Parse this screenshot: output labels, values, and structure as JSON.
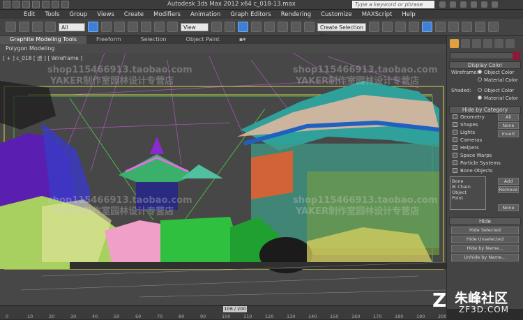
{
  "window": {
    "title": "Autodesk 3ds Max  2012 x64      c_018-13.max",
    "search_placeholder": "Type a keyword or phrase"
  },
  "menu": [
    "Edit",
    "Tools",
    "Group",
    "Views",
    "Create",
    "Modifiers",
    "Animation",
    "Graph Editors",
    "Rendering",
    "Customize",
    "MAXScript",
    "Help"
  ],
  "toolbar": {
    "filter_value": "All",
    "refcoord_value": "View",
    "selection_set_value": "Create Selection Se"
  },
  "ribbon": {
    "tabs": [
      "Graphite Modeling Tools",
      "Freeform",
      "Selection",
      "Object Paint"
    ],
    "active_tab": "Graphite Modeling Tools",
    "sub_label": "Polygon Modeling"
  },
  "viewport": {
    "label": "[ + ] c_018 [ 透 ] [ Wireframe ]",
    "watermark": "shop115466913.taobao.com",
    "watermark_cn": "YAKER制作室园林设计专营店"
  },
  "command_panel": {
    "display_color": {
      "title": "Display Color",
      "wireframe_label": "Wireframe:",
      "shaded_label": "Shaded:",
      "opt_object": "Object Color",
      "opt_material": "Material Color"
    },
    "hide_by_category": {
      "title": "Hide by Category",
      "items": [
        "Geometry",
        "Shapes",
        "Lights",
        "Cameras",
        "Helpers",
        "Space Warps",
        "Particle Systems",
        "Bone Objects"
      ],
      "all_btn": "All",
      "none_btn": "None",
      "invert_btn": "Invert",
      "list_items": [
        "Bone",
        "IK Chain Object",
        "Point"
      ],
      "add_btn": "Add",
      "remove_btn": "Remove",
      "none2_btn": "None"
    },
    "hide": {
      "title": "Hide",
      "buttons": [
        "Hide Selected",
        "Hide Unselected",
        "Hide by Name...",
        "Unhide by Name..."
      ]
    }
  },
  "timeline": {
    "slider_label": "106 / 200",
    "ticks": [
      "0",
      "10",
      "20",
      "30",
      "40",
      "50",
      "60",
      "70",
      "80",
      "90",
      "100",
      "110",
      "120",
      "130",
      "140",
      "150",
      "160",
      "170",
      "180",
      "190",
      "200"
    ]
  },
  "brand": {
    "logo": "Z",
    "name": "朱峰社区",
    "url": "ZF3D.COM"
  }
}
